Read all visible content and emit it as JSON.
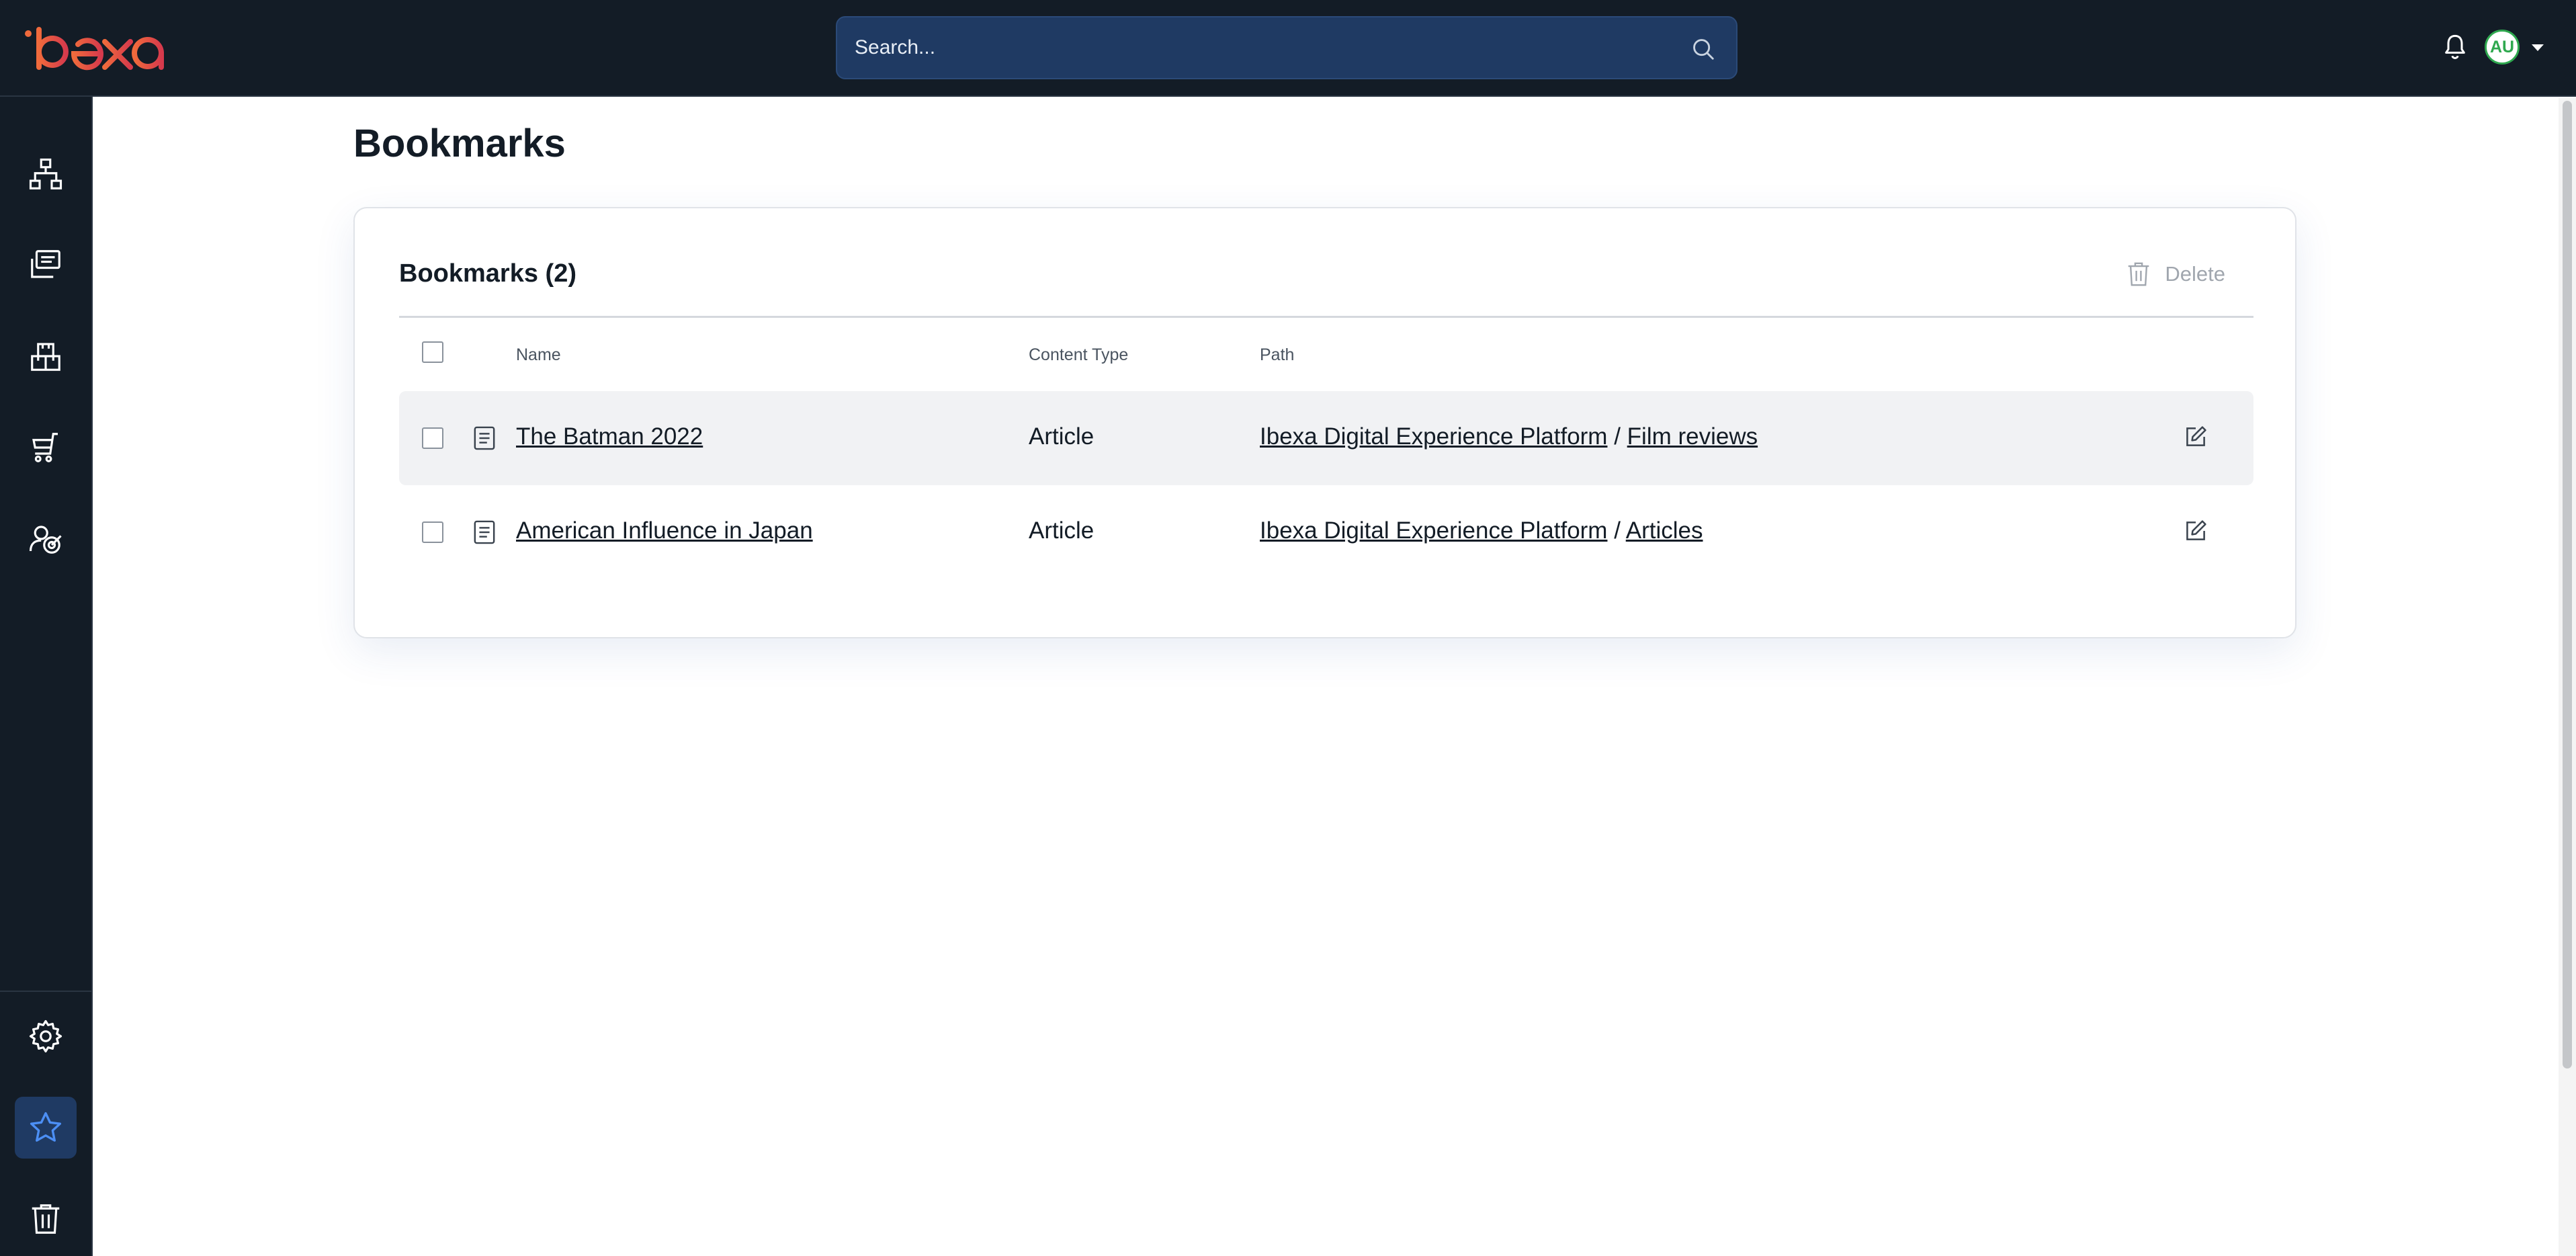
{
  "header": {
    "logo_text": "ibexa",
    "search": {
      "placeholder": "Search...",
      "value": ""
    },
    "user": {
      "initials": "AU"
    }
  },
  "sidebar": {
    "items": [
      {
        "name": "content-structure",
        "icon": "content-tree-icon",
        "active": false
      },
      {
        "name": "content",
        "icon": "content-icon",
        "active": false
      },
      {
        "name": "product-catalog",
        "icon": "product-catalog-icon",
        "active": false
      },
      {
        "name": "commerce",
        "icon": "cart-icon",
        "active": false
      },
      {
        "name": "personalization",
        "icon": "target-icon",
        "active": false
      }
    ],
    "bottom_items": [
      {
        "name": "admin",
        "icon": "gear-icon",
        "active": false
      },
      {
        "name": "bookmarks",
        "icon": "star-icon",
        "active": true
      },
      {
        "name": "trash",
        "icon": "trash-icon",
        "active": false
      }
    ]
  },
  "page": {
    "title": "Bookmarks"
  },
  "bookmarks": {
    "title": "Bookmarks (2)",
    "delete_label": "Delete",
    "columns": {
      "name": "Name",
      "content_type": "Content Type",
      "path": "Path"
    },
    "rows": [
      {
        "name": "The Batman 2022",
        "content_type": "Article",
        "path": [
          "Ibexa Digital Experience Platform",
          "Film reviews"
        ],
        "separator": "/"
      },
      {
        "name": "American Influence in Japan",
        "content_type": "Article",
        "path": [
          "Ibexa Digital Experience Platform",
          "Articles"
        ],
        "separator": "/"
      }
    ]
  },
  "colors": {
    "topbar_bg": "#131c26",
    "search_bg": "#1f3a63",
    "active_item_bg": "#1f3a63",
    "logo_accent": "#e8513f",
    "avatar_accent": "#2fa84f"
  }
}
